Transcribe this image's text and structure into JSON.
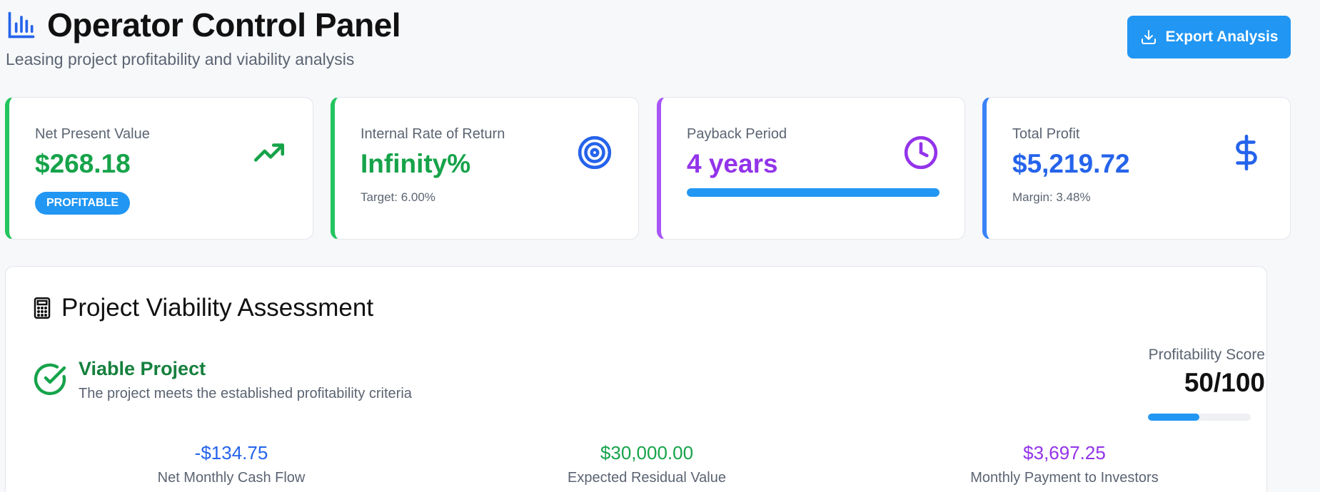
{
  "header": {
    "title": "Operator Control Panel",
    "subtitle": "Leasing project profitability and viability analysis",
    "title_icon": "bar-chart-icon",
    "export_label": "Export Analysis",
    "export_icon": "download-icon"
  },
  "kpis": [
    {
      "label": "Net Present Value",
      "value": "$268.18",
      "badge": "PROFITABLE",
      "icon": "trending-up-icon",
      "accent": "#22c55e"
    },
    {
      "label": "Internal Rate of Return",
      "value": "Infinity%",
      "sub": "Target: 6.00%",
      "icon": "target-icon",
      "accent": "#22c55e"
    },
    {
      "label": "Payback Period",
      "value": "4 years",
      "progress_percent": 100,
      "icon": "clock-icon",
      "accent": "#a855f7"
    },
    {
      "label": "Total Profit",
      "value": "$5,219.72",
      "sub": "Margin: 3.48%",
      "icon": "dollar-icon",
      "accent": "#3b82f6"
    }
  ],
  "assessment": {
    "title": "Project Viability Assessment",
    "title_icon": "calculator-icon",
    "status_title": "Viable Project",
    "status_desc": "The project meets the established profitability criteria",
    "status_icon": "check-circle-icon",
    "score_label": "Profitability Score",
    "score_value": "50/100",
    "score_percent": 50,
    "metrics": [
      {
        "value": "-$134.75",
        "label": "Net Monthly Cash Flow",
        "color": "#2563eb"
      },
      {
        "value": "$30,000.00",
        "label": "Expected Residual Value",
        "color": "#16a34a"
      },
      {
        "value": "$3,697.25",
        "label": "Monthly Payment to Investors",
        "color": "#9333ea"
      }
    ]
  },
  "colors": {
    "primary": "#2196f3",
    "green": "#16a34a",
    "purple": "#9333ea",
    "blue": "#2563eb"
  }
}
